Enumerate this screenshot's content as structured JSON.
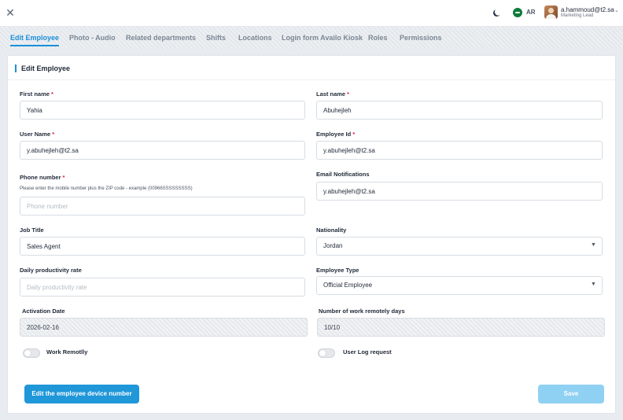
{
  "header": {
    "close_icon": "close-icon",
    "theme_icon": "moon-icon",
    "language": "AR",
    "user_email": "a.hammoud@t2.sa",
    "user_role": "Marketing Lead"
  },
  "tabs": [
    {
      "label": "Edit Employee",
      "active": true
    },
    {
      "label": "Photo - Audio"
    },
    {
      "label": "Related departments"
    },
    {
      "label": "Shifts"
    },
    {
      "label": "Locations"
    },
    {
      "label": "Login form Availo Kiosk"
    },
    {
      "label": "Roles"
    },
    {
      "label": "Permissions"
    }
  ],
  "form": {
    "title": "Edit Employee",
    "first_name": {
      "label": "First name",
      "value": "Yahia"
    },
    "last_name": {
      "label": "Last name",
      "value": "Abuhejleh"
    },
    "user_name": {
      "label": "User Name",
      "value": "y.abuhejleh@t2.sa"
    },
    "employee_id": {
      "label": "Employee Id",
      "value": "y.abuhejleh@t2.sa"
    },
    "phone": {
      "label": "Phone number",
      "hint": "Please enter the mobile number plus the ZIP code - example (00966SSSSSSSSS)",
      "placeholder": "Phone number"
    },
    "email_notifications": {
      "label": "Email Notifications",
      "value": "y.abuhejleh@t2.sa"
    },
    "job_title": {
      "label": "Job Title",
      "value": "Sales Agent"
    },
    "nationality": {
      "label": "Nationality",
      "value": "Jordan"
    },
    "daily_productivity": {
      "label": "Daily productivity rate",
      "placeholder": "Daily productivity rate"
    },
    "employee_type": {
      "label": "Employee Type",
      "value": "Official Employee"
    },
    "activation_date": {
      "label": "Activation Date",
      "value": "2026-02-16"
    },
    "remote_days": {
      "label": "Number of work remotely days",
      "value": "10/10"
    },
    "work_remotely": {
      "label": "Work Remotlly",
      "on": false
    },
    "user_log_request": {
      "label": "User Log request",
      "on": false
    }
  },
  "actions": {
    "device_number_label": "Edit the employee device number",
    "save_label": "Save"
  },
  "colors": {
    "accent": "#1b8fd8",
    "required": "#e11d48",
    "save_disabled": "#8fd1f2"
  }
}
